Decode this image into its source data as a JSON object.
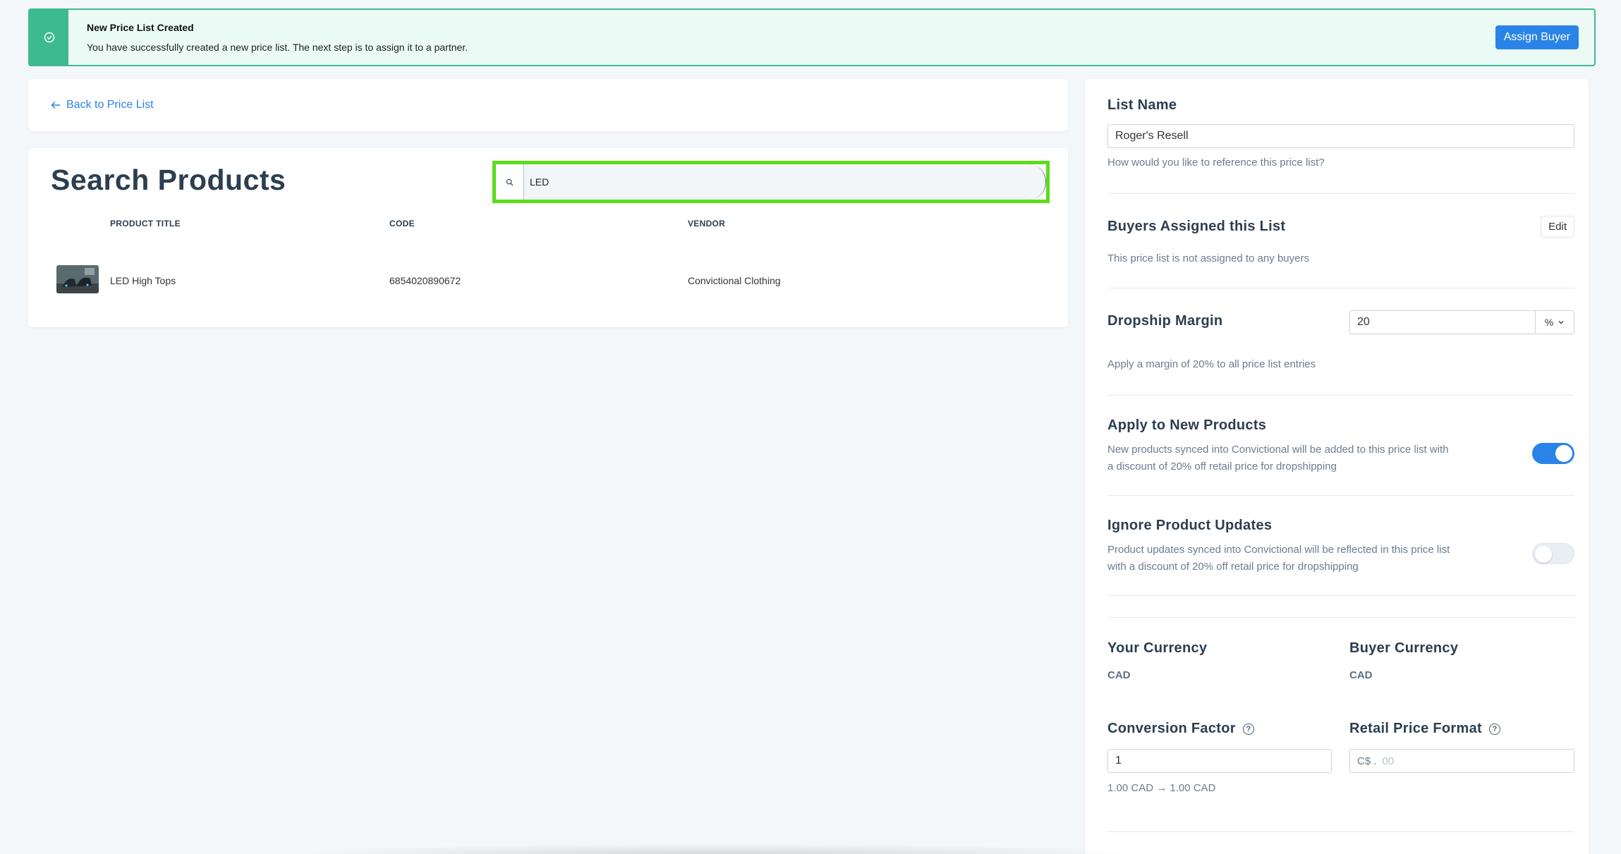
{
  "banner": {
    "title": "New Price List Created",
    "message": "You have successfully created a new price list. The next step is to assign it to a partner.",
    "button": "Assign Buyer",
    "icon": "check-circle-icon"
  },
  "nav": {
    "back_label": "Back to Price List"
  },
  "search": {
    "title": "Search Products",
    "query": "LED",
    "columns": [
      "PRODUCT TITLE",
      "CODE",
      "VENDOR"
    ],
    "rows": [
      {
        "title": "LED High Tops",
        "code": "6854020890672",
        "vendor": "Convictional Clothing"
      }
    ]
  },
  "settings": {
    "list_name": {
      "label": "List Name",
      "value": "Roger's Resell",
      "help": "How would you like to reference this price list?"
    },
    "buyers": {
      "label": "Buyers Assigned this List",
      "edit": "Edit",
      "help": "This price list is not assigned to any buyers"
    },
    "margin": {
      "label": "Dropship Margin",
      "value": "20",
      "unit": "%",
      "help": "Apply a margin of 20% to all price list entries"
    },
    "apply_new": {
      "label": "Apply to New Products",
      "help_line1": "New products synced into Convictional will be added to this price list with",
      "help_line2": "a discount of 20% off retail price for dropshipping",
      "enabled": true
    },
    "ignore_updates": {
      "label": "Ignore Product Updates",
      "help_line1": "Product updates synced into Convictional will be reflected in this price list",
      "help_line2": "with a discount of 20% off retail price for dropshipping",
      "enabled": false
    },
    "your_currency": {
      "label": "Your Currency",
      "value": "CAD"
    },
    "buyer_currency": {
      "label": "Buyer Currency",
      "value": "CAD"
    },
    "conversion": {
      "label": "Conversion Factor",
      "value": "1",
      "help": "1.00 CAD → 1.00 CAD"
    },
    "retail_format": {
      "label": "Retail Price Format",
      "prefix": "C$ .",
      "placeholder": "00"
    }
  },
  "colors": {
    "accent": "#2a84e8",
    "success": "#3dba8f",
    "highlight": "#5cdd1b"
  }
}
